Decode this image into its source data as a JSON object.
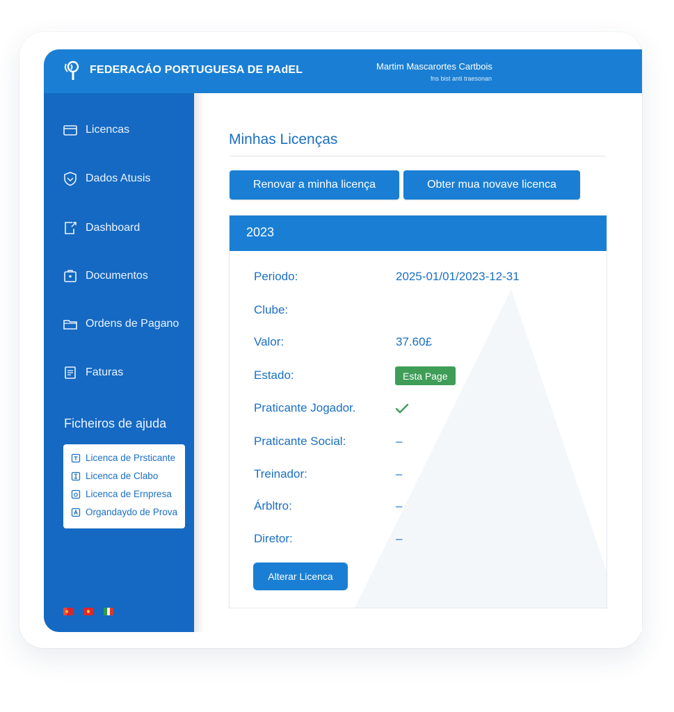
{
  "header": {
    "brand": "FEDERACÁO PORTUGUESA DE PAdEL",
    "user_name": "Martim Mascarortes Cartbois",
    "user_subtitle": "fns bist anti traesonan"
  },
  "sidebar": {
    "items": [
      {
        "label": "Licencas",
        "icon": "briefcase-icon"
      },
      {
        "label": "Dados Atusis",
        "icon": "shield-icon"
      },
      {
        "label": "Dashboard",
        "icon": "export-icon"
      },
      {
        "label": "Documentos",
        "icon": "document-box-icon"
      },
      {
        "label": "Ordens de Pagano",
        "icon": "folder-icon"
      },
      {
        "label": "Faturas",
        "icon": "invoice-icon"
      }
    ],
    "help_title": "Ficheiros de ajuda",
    "help_items": [
      {
        "label": "Licenca de Prsticante",
        "icon": "file-icon"
      },
      {
        "label": "Licenca de Clabo",
        "icon": "file-icon"
      },
      {
        "label": "Licenca de Ernpresa",
        "icon": "file-icon"
      },
      {
        "label": "Organdaydo de Prova",
        "icon": "file-icon"
      }
    ],
    "flags": [
      "flag-icon",
      "flag-icon",
      "italy-flag-icon"
    ]
  },
  "main": {
    "title": "Minhas Licenças",
    "renew_button": "Renovar a minha licença",
    "new_button": "Obter mua novave licenca",
    "panel": {
      "year": "2023",
      "rows": [
        {
          "label": "Periodo:",
          "value": "2025-01/01/2023-12-31"
        },
        {
          "label": "Clube:",
          "value": ""
        },
        {
          "label": "Valor:",
          "value": "37.60£"
        },
        {
          "label": "Estado:",
          "value": ""
        },
        {
          "label": "Praticante Jogador.",
          "value": ""
        },
        {
          "label": "Praticante Social:",
          "value": "–"
        },
        {
          "label": "Treinador:",
          "value": "–"
        },
        {
          "label": "Árbltro:",
          "value": "–"
        },
        {
          "label": "Diretor:",
          "value": "–"
        }
      ],
      "status_badge": "Esta Page",
      "alter_button": "Alterar Licenca"
    }
  },
  "colors": {
    "header": "#1a7fd4",
    "sidebar": "#1569c2",
    "accent": "#1a6fc4",
    "success": "#3f9d57"
  }
}
